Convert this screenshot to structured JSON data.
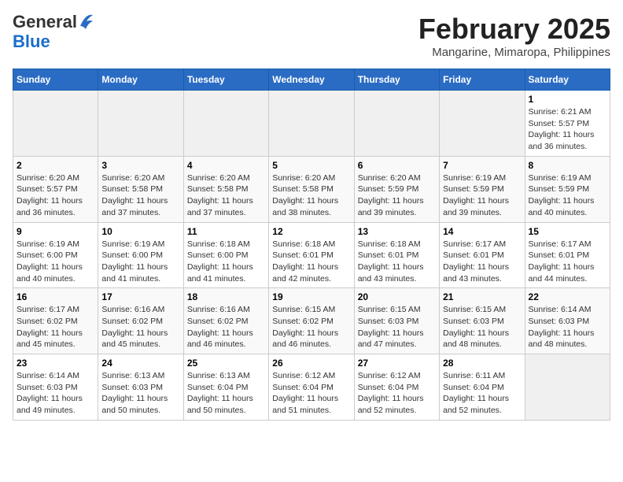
{
  "header": {
    "logo_general": "General",
    "logo_blue": "Blue",
    "month_title": "February 2025",
    "location": "Mangarine, Mimaropa, Philippines"
  },
  "calendar": {
    "headers": [
      "Sunday",
      "Monday",
      "Tuesday",
      "Wednesday",
      "Thursday",
      "Friday",
      "Saturday"
    ],
    "weeks": [
      [
        {
          "day": "",
          "info": ""
        },
        {
          "day": "",
          "info": ""
        },
        {
          "day": "",
          "info": ""
        },
        {
          "day": "",
          "info": ""
        },
        {
          "day": "",
          "info": ""
        },
        {
          "day": "",
          "info": ""
        },
        {
          "day": "1",
          "info": "Sunrise: 6:21 AM\nSunset: 5:57 PM\nDaylight: 11 hours and 36 minutes."
        }
      ],
      [
        {
          "day": "2",
          "info": "Sunrise: 6:20 AM\nSunset: 5:57 PM\nDaylight: 11 hours and 36 minutes."
        },
        {
          "day": "3",
          "info": "Sunrise: 6:20 AM\nSunset: 5:58 PM\nDaylight: 11 hours and 37 minutes."
        },
        {
          "day": "4",
          "info": "Sunrise: 6:20 AM\nSunset: 5:58 PM\nDaylight: 11 hours and 37 minutes."
        },
        {
          "day": "5",
          "info": "Sunrise: 6:20 AM\nSunset: 5:58 PM\nDaylight: 11 hours and 38 minutes."
        },
        {
          "day": "6",
          "info": "Sunrise: 6:20 AM\nSunset: 5:59 PM\nDaylight: 11 hours and 39 minutes."
        },
        {
          "day": "7",
          "info": "Sunrise: 6:19 AM\nSunset: 5:59 PM\nDaylight: 11 hours and 39 minutes."
        },
        {
          "day": "8",
          "info": "Sunrise: 6:19 AM\nSunset: 5:59 PM\nDaylight: 11 hours and 40 minutes."
        }
      ],
      [
        {
          "day": "9",
          "info": "Sunrise: 6:19 AM\nSunset: 6:00 PM\nDaylight: 11 hours and 40 minutes."
        },
        {
          "day": "10",
          "info": "Sunrise: 6:19 AM\nSunset: 6:00 PM\nDaylight: 11 hours and 41 minutes."
        },
        {
          "day": "11",
          "info": "Sunrise: 6:18 AM\nSunset: 6:00 PM\nDaylight: 11 hours and 41 minutes."
        },
        {
          "day": "12",
          "info": "Sunrise: 6:18 AM\nSunset: 6:01 PM\nDaylight: 11 hours and 42 minutes."
        },
        {
          "day": "13",
          "info": "Sunrise: 6:18 AM\nSunset: 6:01 PM\nDaylight: 11 hours and 43 minutes."
        },
        {
          "day": "14",
          "info": "Sunrise: 6:17 AM\nSunset: 6:01 PM\nDaylight: 11 hours and 43 minutes."
        },
        {
          "day": "15",
          "info": "Sunrise: 6:17 AM\nSunset: 6:01 PM\nDaylight: 11 hours and 44 minutes."
        }
      ],
      [
        {
          "day": "16",
          "info": "Sunrise: 6:17 AM\nSunset: 6:02 PM\nDaylight: 11 hours and 45 minutes."
        },
        {
          "day": "17",
          "info": "Sunrise: 6:16 AM\nSunset: 6:02 PM\nDaylight: 11 hours and 45 minutes."
        },
        {
          "day": "18",
          "info": "Sunrise: 6:16 AM\nSunset: 6:02 PM\nDaylight: 11 hours and 46 minutes."
        },
        {
          "day": "19",
          "info": "Sunrise: 6:15 AM\nSunset: 6:02 PM\nDaylight: 11 hours and 46 minutes."
        },
        {
          "day": "20",
          "info": "Sunrise: 6:15 AM\nSunset: 6:03 PM\nDaylight: 11 hours and 47 minutes."
        },
        {
          "day": "21",
          "info": "Sunrise: 6:15 AM\nSunset: 6:03 PM\nDaylight: 11 hours and 48 minutes."
        },
        {
          "day": "22",
          "info": "Sunrise: 6:14 AM\nSunset: 6:03 PM\nDaylight: 11 hours and 48 minutes."
        }
      ],
      [
        {
          "day": "23",
          "info": "Sunrise: 6:14 AM\nSunset: 6:03 PM\nDaylight: 11 hours and 49 minutes."
        },
        {
          "day": "24",
          "info": "Sunrise: 6:13 AM\nSunset: 6:03 PM\nDaylight: 11 hours and 50 minutes."
        },
        {
          "day": "25",
          "info": "Sunrise: 6:13 AM\nSunset: 6:04 PM\nDaylight: 11 hours and 50 minutes."
        },
        {
          "day": "26",
          "info": "Sunrise: 6:12 AM\nSunset: 6:04 PM\nDaylight: 11 hours and 51 minutes."
        },
        {
          "day": "27",
          "info": "Sunrise: 6:12 AM\nSunset: 6:04 PM\nDaylight: 11 hours and 52 minutes."
        },
        {
          "day": "28",
          "info": "Sunrise: 6:11 AM\nSunset: 6:04 PM\nDaylight: 11 hours and 52 minutes."
        },
        {
          "day": "",
          "info": ""
        }
      ]
    ]
  }
}
